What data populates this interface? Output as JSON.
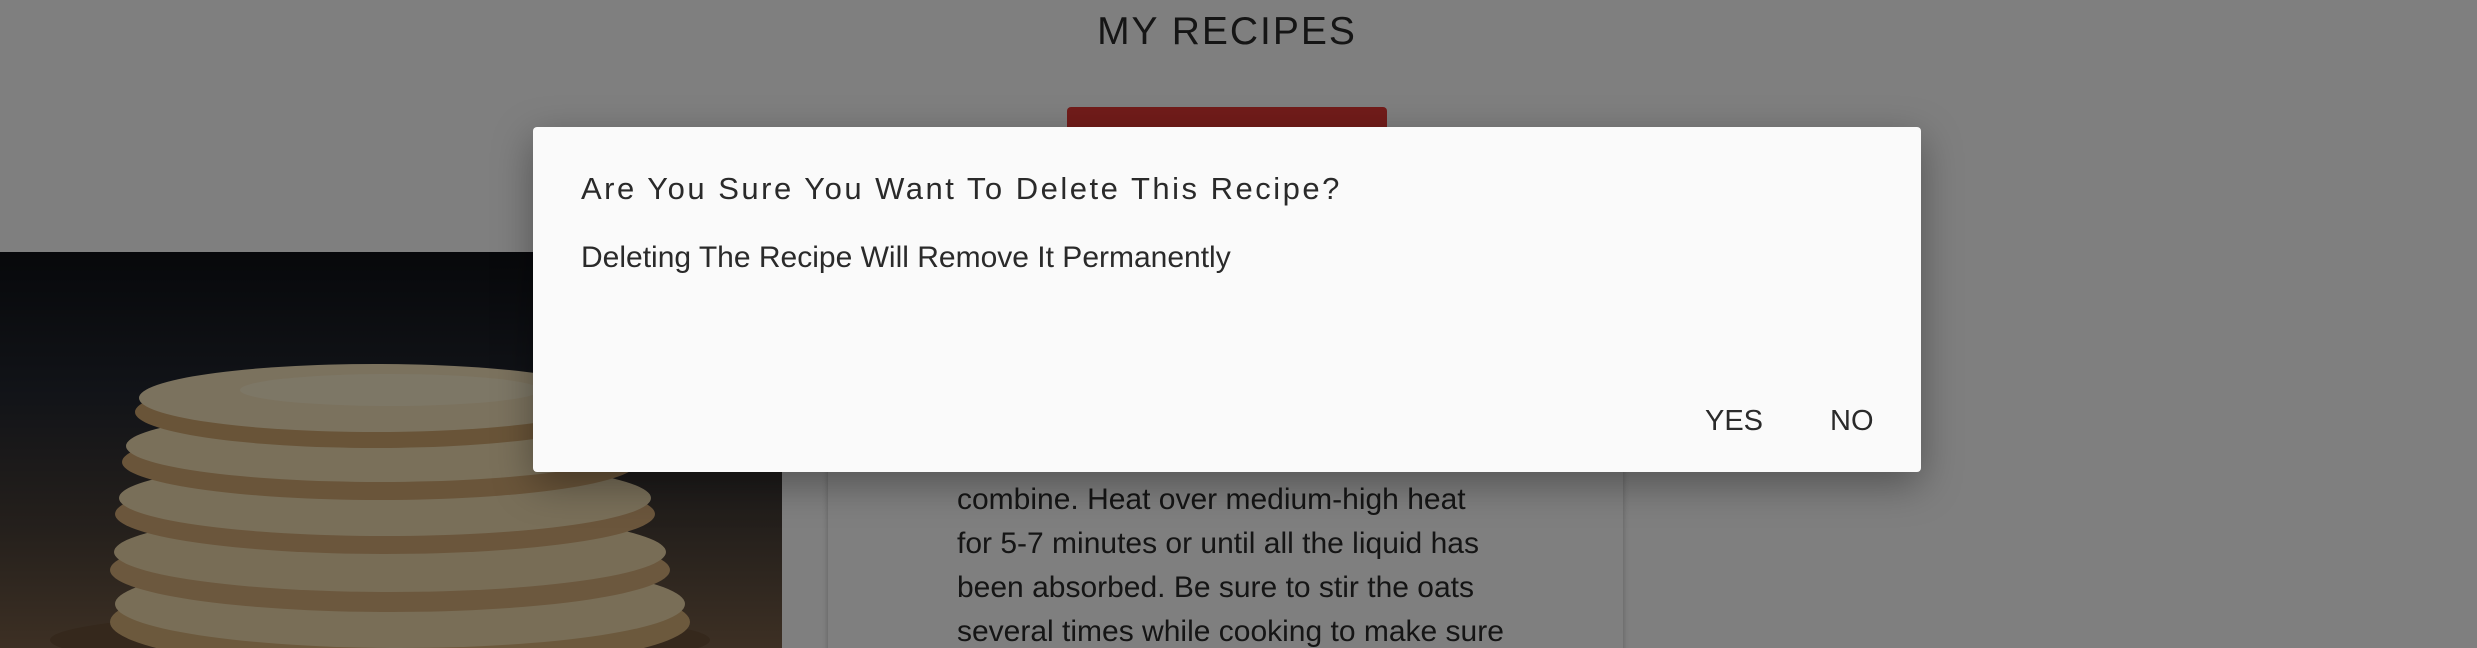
{
  "page": {
    "title": "MY RECIPES"
  },
  "recipe": {
    "instructions_lines": [
      "combine. Heat over medium-high heat",
      "for 5-7 minutes or until all the liquid has",
      "been absorbed. Be sure to stir the oats",
      "several times while cooking to make sure"
    ],
    "image_subject": "pancake-stack-photo"
  },
  "dialog": {
    "title": "Are You Sure You Want To Delete This Recipe?",
    "body": "Deleting The Recipe Will Remove It Permanently",
    "yes_label": "YES",
    "no_label": "NO"
  },
  "colors": {
    "overlay": "rgba(0,0,0,0.5)",
    "dialog_bg": "#fafafa",
    "primary_button": "#e53935",
    "text": "#2a2a2a"
  }
}
